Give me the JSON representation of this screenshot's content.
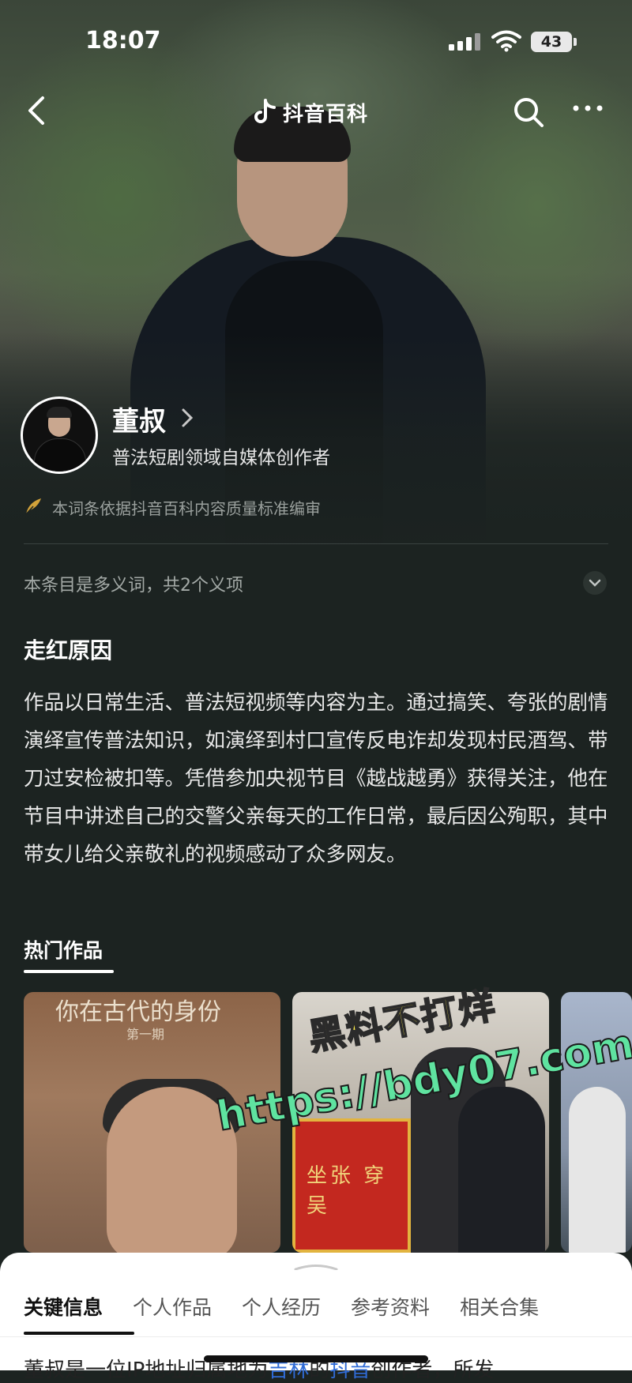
{
  "status_bar": {
    "time": "18:07",
    "battery": "43"
  },
  "nav": {
    "title": "抖音百科"
  },
  "profile": {
    "name": "董叔",
    "subtitle": "普法短剧领域自媒体创作者",
    "review_note": "本词条依据抖音百科内容质量标准编审"
  },
  "polysemy": {
    "text": "本条目是多义词，共2个义项"
  },
  "reason": {
    "heading": "走红原因",
    "body": "作品以日常生活、普法短视频等内容为主。通过搞笑、夸张的剧情演绎宣传普法知识，如演绎到村口宣传反电诈却发现村民酒驾、带刀过安检被扣等。凭借参加央视节目《越战越勇》获得关注，他在节目中讲述自己的交警父亲每天的工作日常，最后因公殉职，其中带女儿给父亲敬礼的视频感动了众多网友。"
  },
  "hot_works": {
    "heading": "热门作品",
    "thumb_1_title": "你在古代的身份",
    "thumb_1_sub": "第一期",
    "thumb_2_banner": "坐张 穿吴"
  },
  "watermark": {
    "line1": "黑料不打烊",
    "line2": "https://bdy07.com"
  },
  "tabs": [
    "关键信息",
    "个人作品",
    "个人经历",
    "参考资料",
    "相关合集"
  ],
  "sheet": {
    "text_prefix": "董叔是一位IP地址归属地为",
    "link_1": "吉林",
    "text_mid": "的",
    "link_2": "抖音",
    "text_suffix": "创作者，所发"
  },
  "colors": {
    "background": "#1c2321",
    "link": "#2f6bd6",
    "watermark_yellow": "#ffef4a",
    "watermark_green": "#5fe3a0"
  }
}
